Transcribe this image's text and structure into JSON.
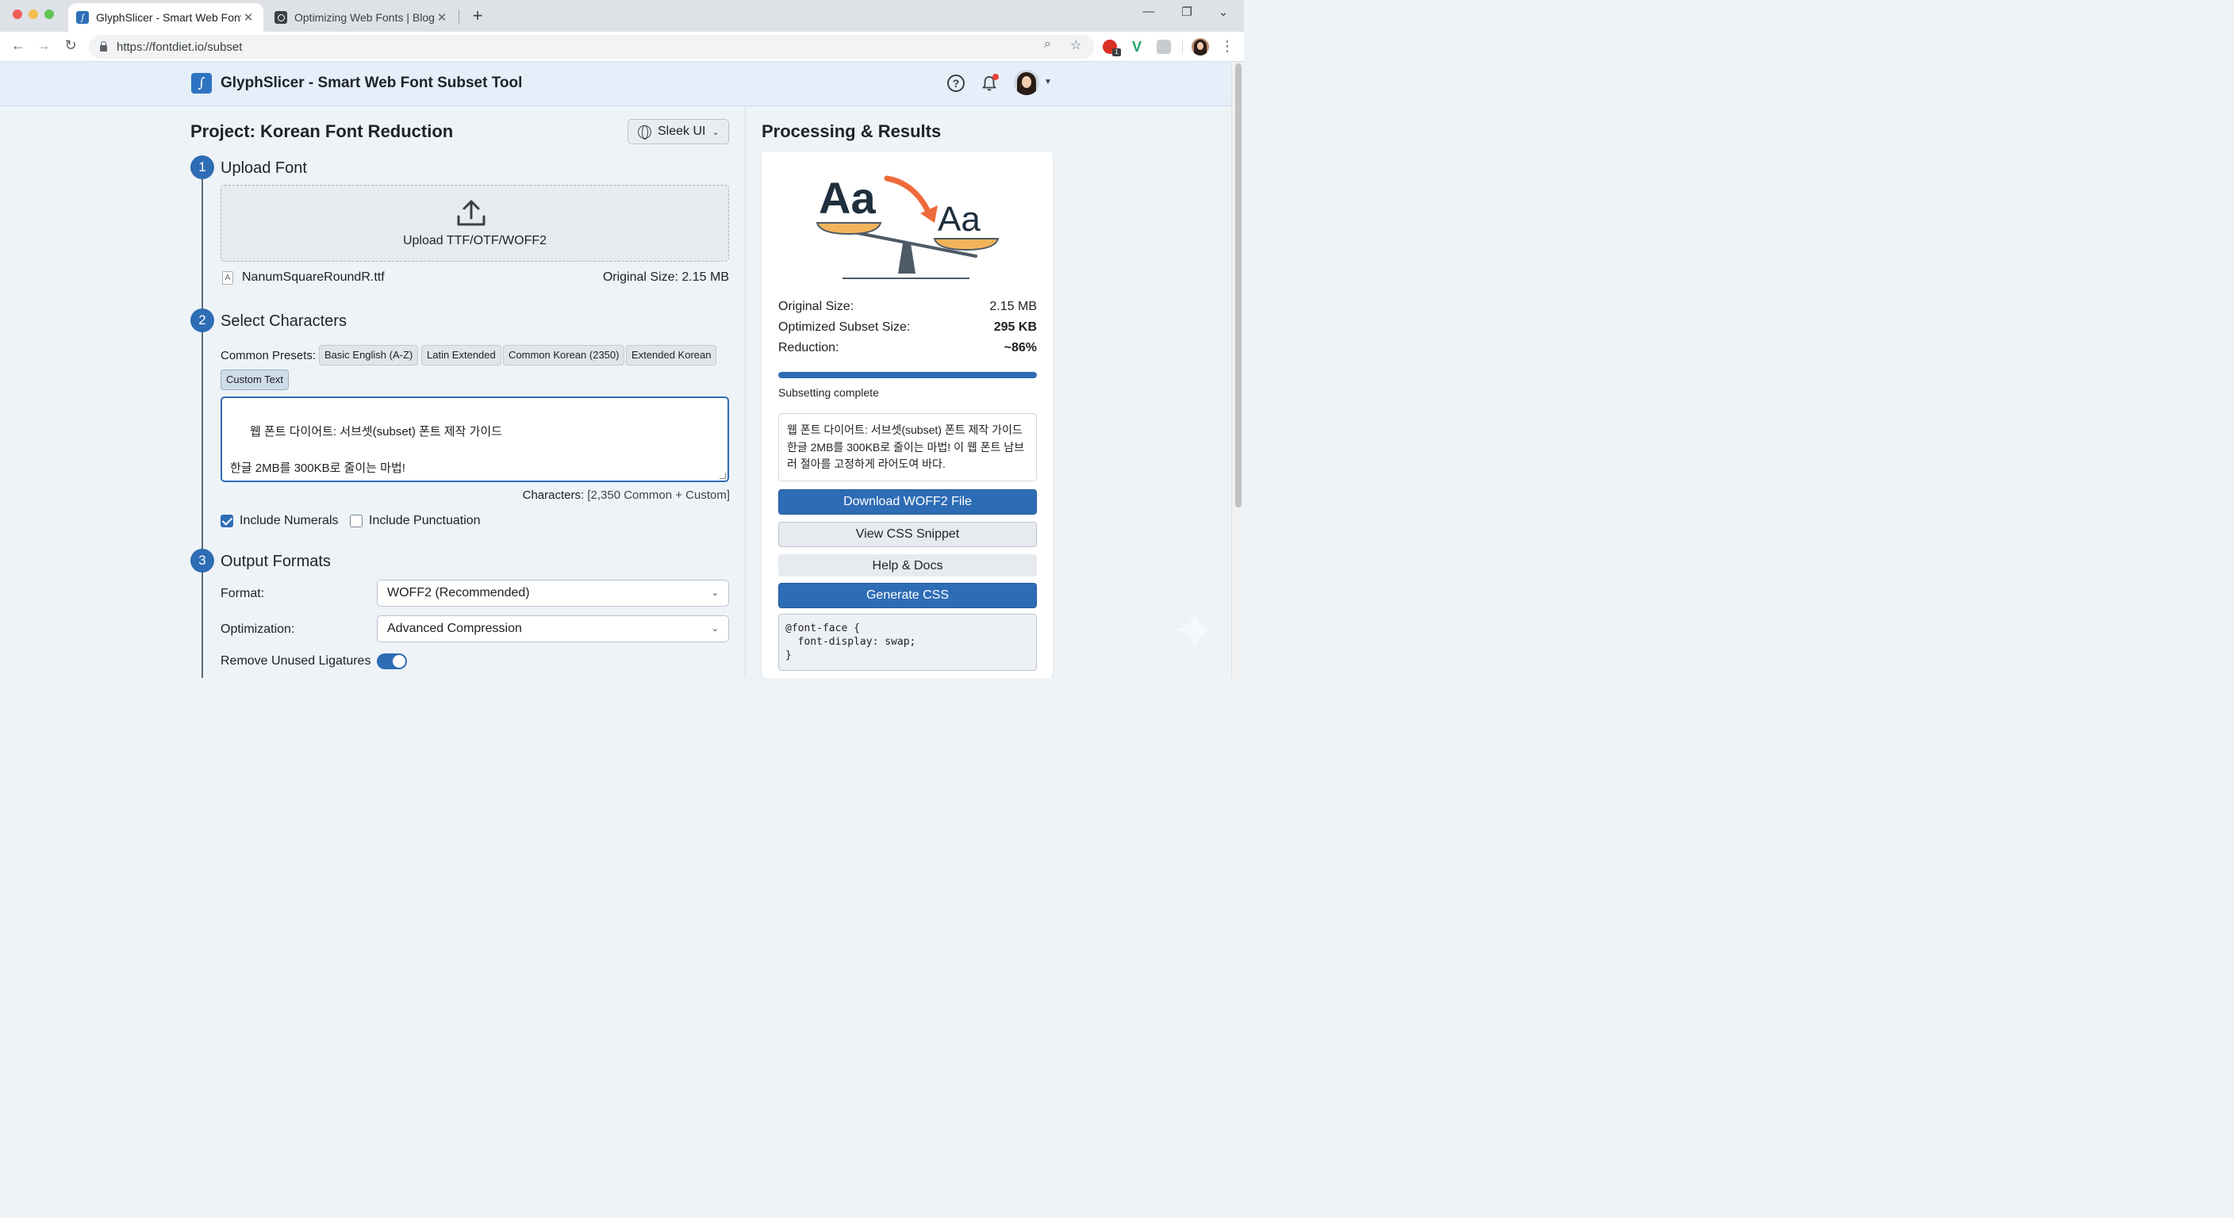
{
  "browser": {
    "tabs": [
      {
        "title": "GlyphSlicer - Smart Web Font",
        "active": true
      },
      {
        "title": "Optimizing Web Fonts | Blog |",
        "active": false
      }
    ],
    "url": "https://fontdiet.io/subset",
    "extension_badge": "1"
  },
  "app": {
    "title": "GlyphSlicer - Smart Web Font Subset Tool",
    "logo_glyph": "∫"
  },
  "project": {
    "title": "Project: Korean Font Reduction",
    "theme_button": "Sleek UI"
  },
  "steps": {
    "upload": {
      "number": "1",
      "title": "Upload Font",
      "dropzone_label": "Upload TTF/OTF/WOFF2",
      "file_icon": "A",
      "file_name": "NanumSquareRoundR.ttf",
      "original_size": "Original Size: 2.15 MB"
    },
    "characters": {
      "number": "2",
      "title": "Select Characters",
      "presets_label": "Common Presets:",
      "presets": [
        "Basic English (A-Z)",
        "Latin Extended",
        "Common Korean (2350)",
        "Extended Korean",
        "Custom Text"
      ],
      "active_preset": "Custom Text",
      "custom_text": "웹 폰트 다이어트: 서브셋(subset) 폰트 제작 가이드\n\n한글 2MB를 300KB로 줄이는 마법!",
      "count_label": "Characters:",
      "count_value": "[2,350 Common + Custom]",
      "include_numerals": {
        "label": "Include Numerals",
        "checked": true
      },
      "include_punctuation": {
        "label": "Include Punctuation",
        "checked": false
      }
    },
    "output": {
      "number": "3",
      "title": "Output Formats",
      "format_label": "Format:",
      "format_value": "WOFF2 (Recommended)",
      "optimization_label": "Optimization:",
      "optimization_value": "Advanced Compression",
      "ligatures_label": "Remove Unused Ligatures",
      "ligatures_on": true
    }
  },
  "results": {
    "title": "Processing & Results",
    "illustration": {
      "big_text": "Aa",
      "small_text": "Aa"
    },
    "stats": [
      {
        "label": "Original Size:",
        "value": "2.15 MB",
        "bold": false
      },
      {
        "label": "Optimized Subset Size:",
        "value": "295 KB",
        "bold": true
      },
      {
        "label": "Reduction:",
        "value": "~86%",
        "bold": true
      }
    ],
    "progress": 1.0,
    "status": "Subsetting complete",
    "preview_text": "웹 폰트 다이어트: 서브셋(subset) 폰트 제작 가이드 한글 2MB를 300KB로 줄이는 마법! 이 웹 폰트 남브 러 절아를 고정하게 라어도여 바다.",
    "buttons": {
      "download": "Download WOFF2 File",
      "view_css": "View CSS Snippet",
      "help": "Help & Docs",
      "generate": "Generate CSS"
    },
    "css_snippet": "@font-face {\n  font-display: swap;\n}"
  },
  "colors": {
    "accent": "#2e6cb5",
    "header_bg": "#e4eff9",
    "arrow": "#ef6a3a",
    "pan": "#f2b35b"
  }
}
